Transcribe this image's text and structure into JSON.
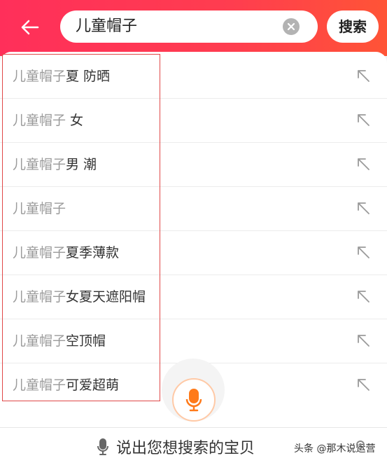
{
  "header": {
    "back_icon": "arrow-left-icon",
    "search_value": "儿童帽子",
    "clear_icon": "clear-circle-icon",
    "search_button_label": "搜索",
    "gradient_colors": [
      "#ff2f5a",
      "#ff5436"
    ]
  },
  "suggestions": [
    {
      "keyword": "儿童帽子",
      "suffix": "夏 防晒"
    },
    {
      "keyword": "儿童帽子",
      "suffix": " 女"
    },
    {
      "keyword": "儿童帽子",
      "suffix": "男 潮"
    },
    {
      "keyword": "儿童帽子",
      "suffix": ""
    },
    {
      "keyword": "儿童帽子",
      "suffix": "夏季薄款"
    },
    {
      "keyword": "儿童帽子",
      "suffix": "女夏天遮阳帽"
    },
    {
      "keyword": "儿童帽子",
      "suffix": "空顶帽"
    },
    {
      "keyword": "儿童帽子",
      "suffix": "可爱超萌"
    }
  ],
  "suggestion_action_icon": "arrow-up-left-icon",
  "voice": {
    "mic_icon": "microphone-icon",
    "hint_text": "说出您想搜索的宝贝",
    "accent_color": "#ff7a1a"
  },
  "watermark": "头条 @那木说运营",
  "highlight_color": "#e04848"
}
